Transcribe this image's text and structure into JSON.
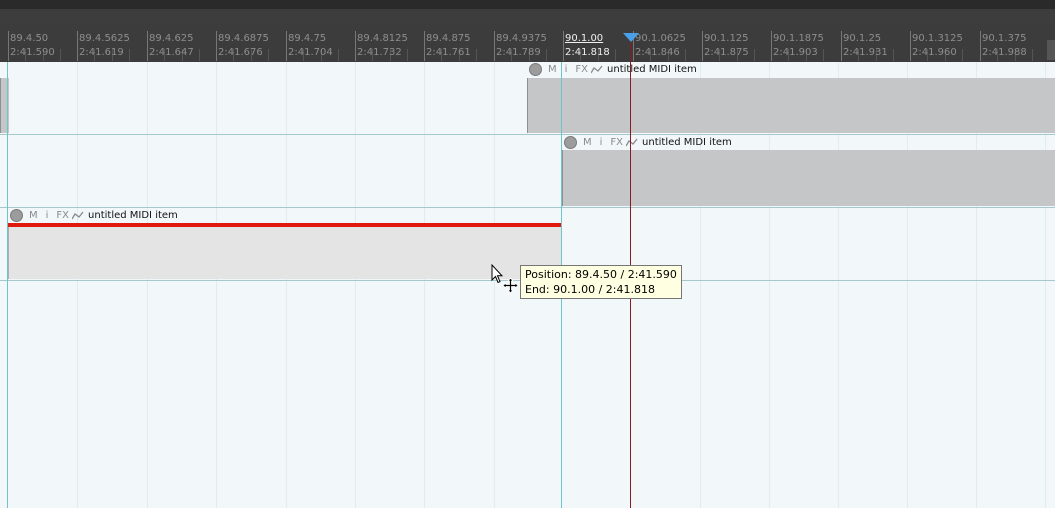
{
  "ruler": {
    "labels": [
      {
        "beat": "89.4.50",
        "time": "2:41.590"
      },
      {
        "beat": "89.4.5625",
        "time": "2:41.619"
      },
      {
        "beat": "89.4.625",
        "time": "2:41.647"
      },
      {
        "beat": "89.4.6875",
        "time": "2:41.676"
      },
      {
        "beat": "89.4.75",
        "time": "2:41.704"
      },
      {
        "beat": "89.4.8125",
        "time": "2:41.732"
      },
      {
        "beat": "89.4.875",
        "time": "2:41.761"
      },
      {
        "beat": "89.4.9375",
        "time": "2:41.789"
      },
      {
        "beat": "90.1.00",
        "time": "2:41.818"
      },
      {
        "beat": "90.1.0625",
        "time": "2:41.846"
      },
      {
        "beat": "90.1.125",
        "time": "2:41.875"
      },
      {
        "beat": "90.1.1875",
        "time": "2:41.903"
      },
      {
        "beat": "90.1.25",
        "time": "2:41.931"
      },
      {
        "beat": "90.1.3125",
        "time": "2:41.960"
      },
      {
        "beat": "90.1.375",
        "time": "2:41.988"
      }
    ]
  },
  "items": {
    "item1": {
      "name": "untitled MIDI item",
      "m": "M",
      "i": "i",
      "fx": "FX"
    },
    "item2": {
      "name": "untitled MIDI item",
      "m": "M",
      "i": "i",
      "fx": "FX"
    },
    "item3": {
      "name": "untitled MIDI item",
      "m": "M",
      "i": "i",
      "fx": "FX"
    }
  },
  "tooltip": {
    "position": "Position: 89.4.50 / 2:41.590",
    "end": "End: 90.1.00 / 2:41.818"
  },
  "colors": {
    "selected_bar": "#e0190e",
    "edit_cursor": "#8c1b1b",
    "snap_line": "#6ec5c7",
    "playhead": "#4aa0e8"
  }
}
